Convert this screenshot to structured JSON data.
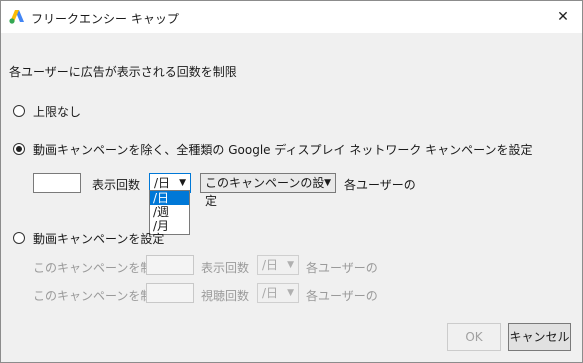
{
  "window": {
    "title": "フリークエンシー キャップ",
    "close_glyph": "✕"
  },
  "heading": "各ユーザーに広告が表示される回数を制限",
  "options": {
    "no_limit": "上限なし",
    "exclude_video": "動画キャンペーンを除く、全種類の Google ディスプレイ ネットワーク キャンペーンを設定",
    "video": "動画キャンペーンを設定"
  },
  "row1": {
    "count_value": "",
    "impressions_label": "表示回数",
    "period_selected": "/日",
    "scope_selected": "このキャンペーンの設定",
    "per_user_label": "各ユーザーの"
  },
  "period_dropdown": {
    "options": [
      "/日",
      "/週",
      "/月"
    ],
    "selected_index": 0
  },
  "video_rows": [
    {
      "prefix": "このキャンペーンを制限",
      "count_value": "",
      "metric_label": "表示回数",
      "period_selected": "/日",
      "per_user_label": "各ユーザーの"
    },
    {
      "prefix": "このキャンペーンを制限",
      "count_value": "",
      "metric_label": "視聴回数",
      "period_selected": "/日",
      "per_user_label": "各ユーザーの"
    }
  ],
  "buttons": {
    "ok": "OK",
    "cancel": "キャンセル"
  },
  "colors": {
    "accent": "#0078d7",
    "logo_blue": "#4285f4",
    "logo_yellow": "#fbbc04",
    "logo_green": "#34a853"
  }
}
